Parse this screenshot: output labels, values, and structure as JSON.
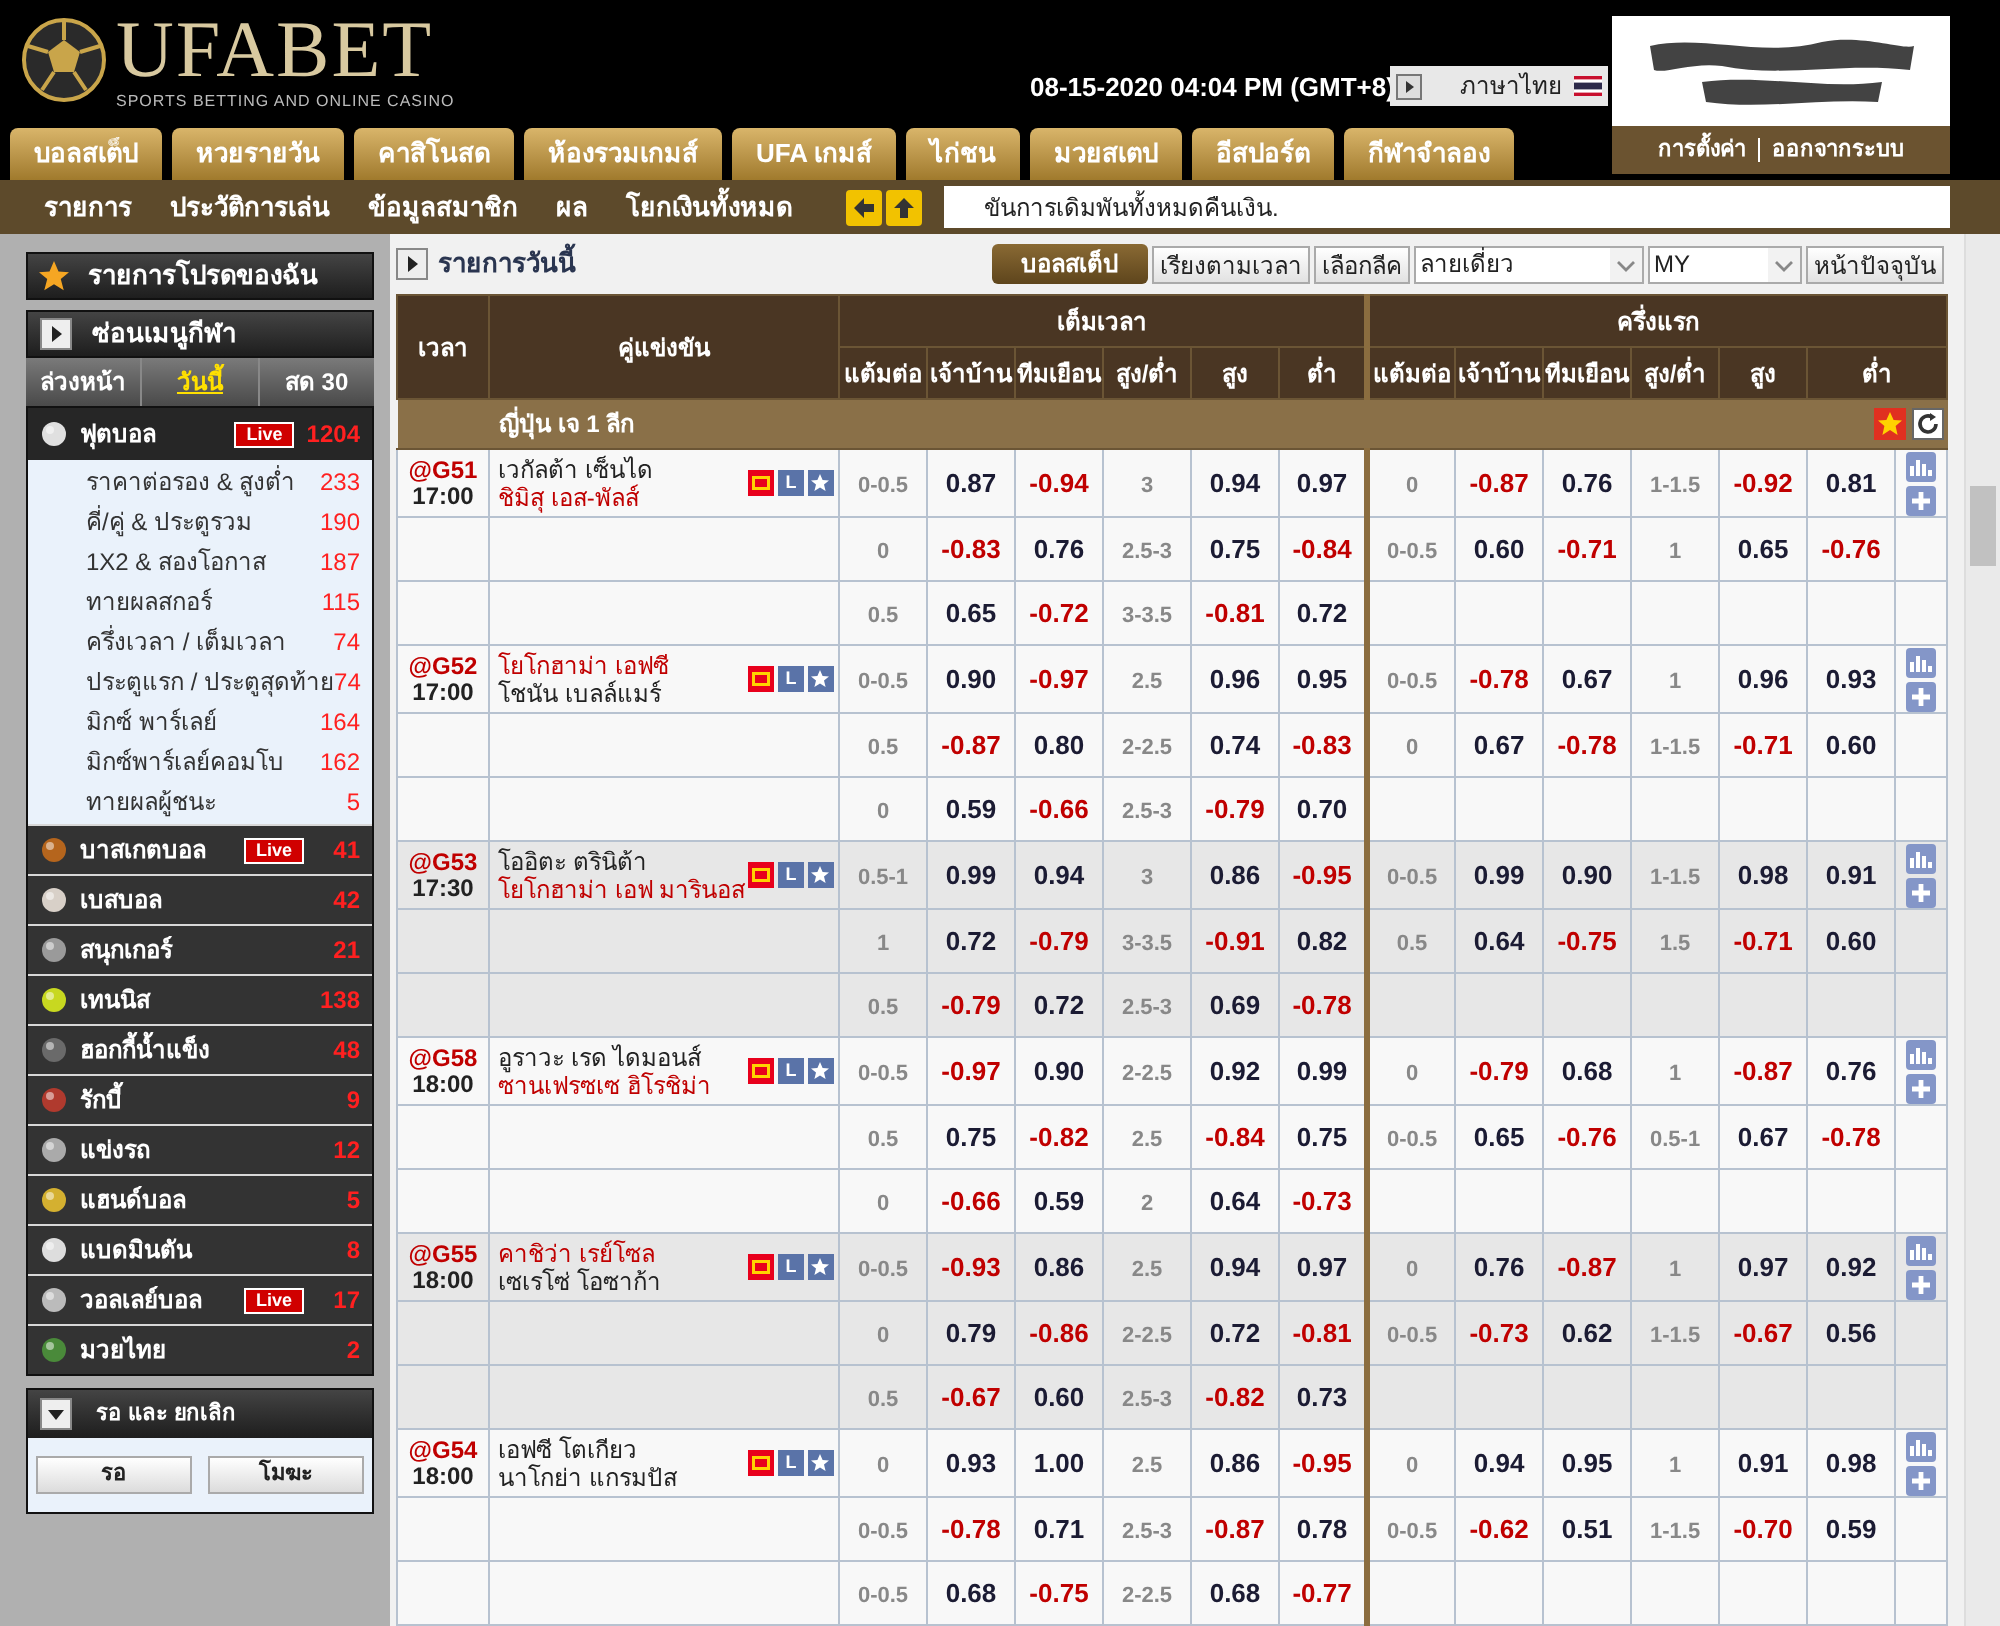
{
  "header": {
    "logo": "UFABET",
    "tagline": "SPORTS BETTING AND ONLINE CASINO",
    "datetime": "08-15-2020 04:04 PM (GMT+8)",
    "language": "ภาษาไทย",
    "account_links": [
      "การตั้งค่า",
      "ออกจากระบบ"
    ]
  },
  "nav_tabs": [
    "บอลสเต็ป",
    "หวยรายวัน",
    "คาสิโนสด",
    "ห้องรวมเกมส์",
    "UFA เกมส์",
    "ไก่ชน",
    "มวยสเตป",
    "อีสปอร์ต",
    "กีฬาจำลอง"
  ],
  "sub_nav": [
    "รายการ",
    "ประวัติการเล่น",
    "ข้อมูลสมาชิก",
    "ผล",
    "โยกเงินทั้งหมด"
  ],
  "ticker": "ขันการเดิมพันทั้งหมดคืนเงิน.",
  "sidebar": {
    "favorites": "รายการโปรดของฉัน",
    "hide_menu": "ซ่อนเมนูกีฬา",
    "periods": [
      {
        "label": "ล่วงหน้า",
        "selected": false
      },
      {
        "label": "วันนี้",
        "selected": true
      },
      {
        "label": "สด 30",
        "selected": false
      }
    ],
    "sports": [
      {
        "name": "ฟุตบอล",
        "badge": "Live",
        "count": "1204",
        "expanded": true,
        "children": [
          {
            "name": "ราคาต่อรอง & สูงต่ำ",
            "count": "233"
          },
          {
            "name": "คี่/คู่ & ประตูรวม",
            "count": "190"
          },
          {
            "name": "1X2 & สองโอกาส",
            "count": "187"
          },
          {
            "name": "ทายผลสกอร์",
            "count": "115"
          },
          {
            "name": "ครึ่งเวลา / เต็มเวลา",
            "count": "74"
          },
          {
            "name": "ประตูแรก / ประตูสุดท้าย",
            "count": "74"
          },
          {
            "name": "มิกซ์ พาร์เลย์",
            "count": "164"
          },
          {
            "name": "มิกซ์พาร์เลย์คอมโบ",
            "count": "162"
          },
          {
            "name": "ทายผลผู้ชนะ",
            "count": "5"
          }
        ]
      },
      {
        "name": "บาสเกตบอล",
        "badge": "Live",
        "count": "41",
        "expanded": false
      },
      {
        "name": "เบสบอล",
        "count": "42",
        "expanded": false
      },
      {
        "name": "สนุกเกอร์",
        "count": "21",
        "expanded": false
      },
      {
        "name": "เทนนิส",
        "count": "138",
        "expanded": false
      },
      {
        "name": "ฮอกกี้น้ำแข็ง",
        "count": "48",
        "expanded": false
      },
      {
        "name": "รักบี้",
        "count": "9",
        "expanded": false
      },
      {
        "name": "แข่งรถ",
        "count": "12",
        "expanded": false
      },
      {
        "name": "แฮนด์บอล",
        "count": "5",
        "expanded": false
      },
      {
        "name": "แบดมินตัน",
        "count": "8",
        "expanded": false
      },
      {
        "name": "วอลเลย์บอล",
        "badge": "Live",
        "count": "17",
        "expanded": false
      },
      {
        "name": "มวยไทย",
        "count": "2",
        "expanded": false
      }
    ],
    "waiting_panel": {
      "title": "รอ และ ยกเลิก",
      "buttons": [
        "รอ",
        "โมฆะ"
      ]
    }
  },
  "main": {
    "title": "รายการวันนี้",
    "toolbar": {
      "active_button": "บอลสเต็ป",
      "buttons": [
        "เรียงตามเวลา",
        "เลือกลีค"
      ],
      "selects": [
        "ลายเดี่ยว",
        "MY"
      ],
      "refresh_button": "หน้าปัจจุบัน"
    },
    "table": {
      "col_time": "เวลา",
      "col_match": "คู่แข่งขัน",
      "groups": [
        {
          "title": "เต็มเวลา",
          "sub_columns": [
            "แต้มต่อ",
            "เจ้าบ้าน",
            "ทีมเยือน",
            "สูง/ต่ำ",
            "สูง",
            "ต่ำ"
          ]
        },
        {
          "title": "ครึ่งแรก",
          "sub_columns": [
            "แต้มต่อ",
            "เจ้าบ้าน",
            "ทีมเยือน",
            "สูง/ต่ำ",
            "สูง",
            "ต่ำ"
          ]
        }
      ],
      "league": "ญี่ปุ่น เจ 1 ลีก",
      "matches": [
        {
          "code": "@G51",
          "time": "17:00",
          "badge": "L",
          "shaded": false,
          "teams": [
            {
              "name": "เวกัลต้า เซ็นได",
              "favored": false
            },
            {
              "name": "ชิมิสุ เอส-พัลส์",
              "favored": true
            }
          ],
          "lines": [
            {
              "ft": [
                "0-0.5",
                "0.87",
                "-0.94",
                "3",
                "0.94",
                "0.97"
              ],
              "ht": [
                "0",
                "-0.87",
                "0.76",
                "1-1.5",
                "-0.92",
                "0.81"
              ]
            },
            {
              "ft": [
                "0",
                "-0.83",
                "0.76",
                "2.5-3",
                "0.75",
                "-0.84"
              ],
              "ht": [
                "0-0.5",
                "0.60",
                "-0.71",
                "1",
                "0.65",
                "-0.76"
              ]
            },
            {
              "ft": [
                "0.5",
                "0.65",
                "-0.72",
                "3-3.5",
                "-0.81",
                "0.72"
              ]
            }
          ]
        },
        {
          "code": "@G52",
          "time": "17:00",
          "badge": "L",
          "shaded": false,
          "teams": [
            {
              "name": "โยโกฮาม่า เอฟซี",
              "favored": true
            },
            {
              "name": "โชนัน เบลล์แมร์",
              "favored": false
            }
          ],
          "lines": [
            {
              "ft": [
                "0-0.5",
                "0.90",
                "-0.97",
                "2.5",
                "0.96",
                "0.95"
              ],
              "ht": [
                "0-0.5",
                "-0.78",
                "0.67",
                "1",
                "0.96",
                "0.93"
              ]
            },
            {
              "ft": [
                "0.5",
                "-0.87",
                "0.80",
                "2-2.5",
                "0.74",
                "-0.83"
              ],
              "ht": [
                "0",
                "0.67",
                "-0.78",
                "1-1.5",
                "-0.71",
                "0.60"
              ]
            },
            {
              "ft": [
                "0",
                "0.59",
                "-0.66",
                "2.5-3",
                "-0.79",
                "0.70"
              ]
            }
          ]
        },
        {
          "code": "@G53",
          "time": "17:30",
          "badge": "L",
          "shaded": true,
          "teams": [
            {
              "name": "โออิตะ ตรินิต้า",
              "favored": false
            },
            {
              "name": "โยโกฮาม่า เอฟ มารินอส",
              "favored": true
            }
          ],
          "lines": [
            {
              "ft": [
                "0.5-1",
                "0.99",
                "0.94",
                "3",
                "0.86",
                "-0.95"
              ],
              "ht": [
                "0-0.5",
                "0.99",
                "0.90",
                "1-1.5",
                "0.98",
                "0.91"
              ]
            },
            {
              "ft": [
                "1",
                "0.72",
                "-0.79",
                "3-3.5",
                "-0.91",
                "0.82"
              ],
              "ht": [
                "0.5",
                "0.64",
                "-0.75",
                "1.5",
                "-0.71",
                "0.60"
              ]
            },
            {
              "ft": [
                "0.5",
                "-0.79",
                "0.72",
                "2.5-3",
                "0.69",
                "-0.78"
              ]
            }
          ]
        },
        {
          "code": "@G58",
          "time": "18:00",
          "badge": "L",
          "shaded": false,
          "teams": [
            {
              "name": "อูราวะ เรด ไดมอนส์",
              "favored": false
            },
            {
              "name": "ซานเฟรซเซ ฮิโรชิม่า",
              "favored": true
            }
          ],
          "lines": [
            {
              "ft": [
                "0-0.5",
                "-0.97",
                "0.90",
                "2-2.5",
                "0.92",
                "0.99"
              ],
              "ht": [
                "0",
                "-0.79",
                "0.68",
                "1",
                "-0.87",
                "0.76"
              ]
            },
            {
              "ft": [
                "0.5",
                "0.75",
                "-0.82",
                "2.5",
                "-0.84",
                "0.75"
              ],
              "ht": [
                "0-0.5",
                "0.65",
                "-0.76",
                "0.5-1",
                "0.67",
                "-0.78"
              ]
            },
            {
              "ft": [
                "0",
                "-0.66",
                "0.59",
                "2",
                "0.64",
                "-0.73"
              ]
            }
          ]
        },
        {
          "code": "@G55",
          "time": "18:00",
          "badge": "L",
          "shaded": true,
          "teams": [
            {
              "name": "คาชิว่า เรย์โซล",
              "favored": true
            },
            {
              "name": "เซเรโซ่ โอซาก้า",
              "favored": false
            }
          ],
          "lines": [
            {
              "ft": [
                "0-0.5",
                "-0.93",
                "0.86",
                "2.5",
                "0.94",
                "0.97"
              ],
              "ht": [
                "0",
                "0.76",
                "-0.87",
                "1",
                "0.97",
                "0.92"
              ]
            },
            {
              "ft": [
                "0",
                "0.79",
                "-0.86",
                "2-2.5",
                "0.72",
                "-0.81"
              ],
              "ht": [
                "0-0.5",
                "-0.73",
                "0.62",
                "1-1.5",
                "-0.67",
                "0.56"
              ]
            },
            {
              "ft": [
                "0.5",
                "-0.67",
                "0.60",
                "2.5-3",
                "-0.82",
                "0.73"
              ]
            }
          ]
        },
        {
          "code": "@G54",
          "time": "18:00",
          "badge": "L",
          "shaded": false,
          "teams": [
            {
              "name": "เอฟซี โตเกียว",
              "favored": false
            },
            {
              "name": "นาโกย่า แกรมปัส",
              "favored": false
            }
          ],
          "lines": [
            {
              "ft": [
                "0",
                "0.93",
                "1.00",
                "2.5",
                "0.86",
                "-0.95"
              ],
              "ht": [
                "0",
                "0.94",
                "0.95",
                "1",
                "0.91",
                "0.98"
              ]
            },
            {
              "ft": [
                "0-0.5",
                "-0.78",
                "0.71",
                "2.5-3",
                "-0.87",
                "0.78"
              ],
              "ht": [
                "0-0.5",
                "-0.62",
                "0.51",
                "1-1.5",
                "-0.70",
                "0.59"
              ]
            },
            {
              "ft": [
                "0-0.5",
                "0.68",
                "-0.75",
                "2-2.5",
                "0.68",
                "-0.77"
              ]
            }
          ]
        }
      ]
    }
  }
}
